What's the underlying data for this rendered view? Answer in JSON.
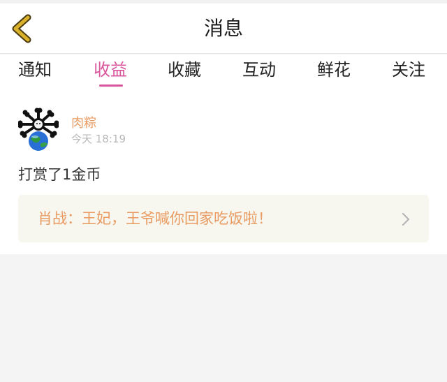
{
  "header": {
    "title": "消息",
    "back_icon": "chevron-left-icon"
  },
  "tabs": [
    {
      "label": "通知",
      "active": false
    },
    {
      "label": "收益",
      "active": true
    },
    {
      "label": "收藏",
      "active": false
    },
    {
      "label": "互动",
      "active": false
    },
    {
      "label": "鲜花",
      "active": false
    },
    {
      "label": "关注",
      "active": false
    }
  ],
  "item": {
    "username": "肉粽",
    "time": "今天 18:19",
    "message": "打赏了1金币",
    "card_text": "肖战：王妃，王爷喊你回家吃饭啦！",
    "card_icon": "chevron-right-icon"
  },
  "colors": {
    "accent_pink": "#d9559c",
    "orange_text": "#e89a60",
    "back_arrow": "#c8a11a",
    "card_bg": "#f7f7f0",
    "page_bg": "#f5f4f4"
  }
}
